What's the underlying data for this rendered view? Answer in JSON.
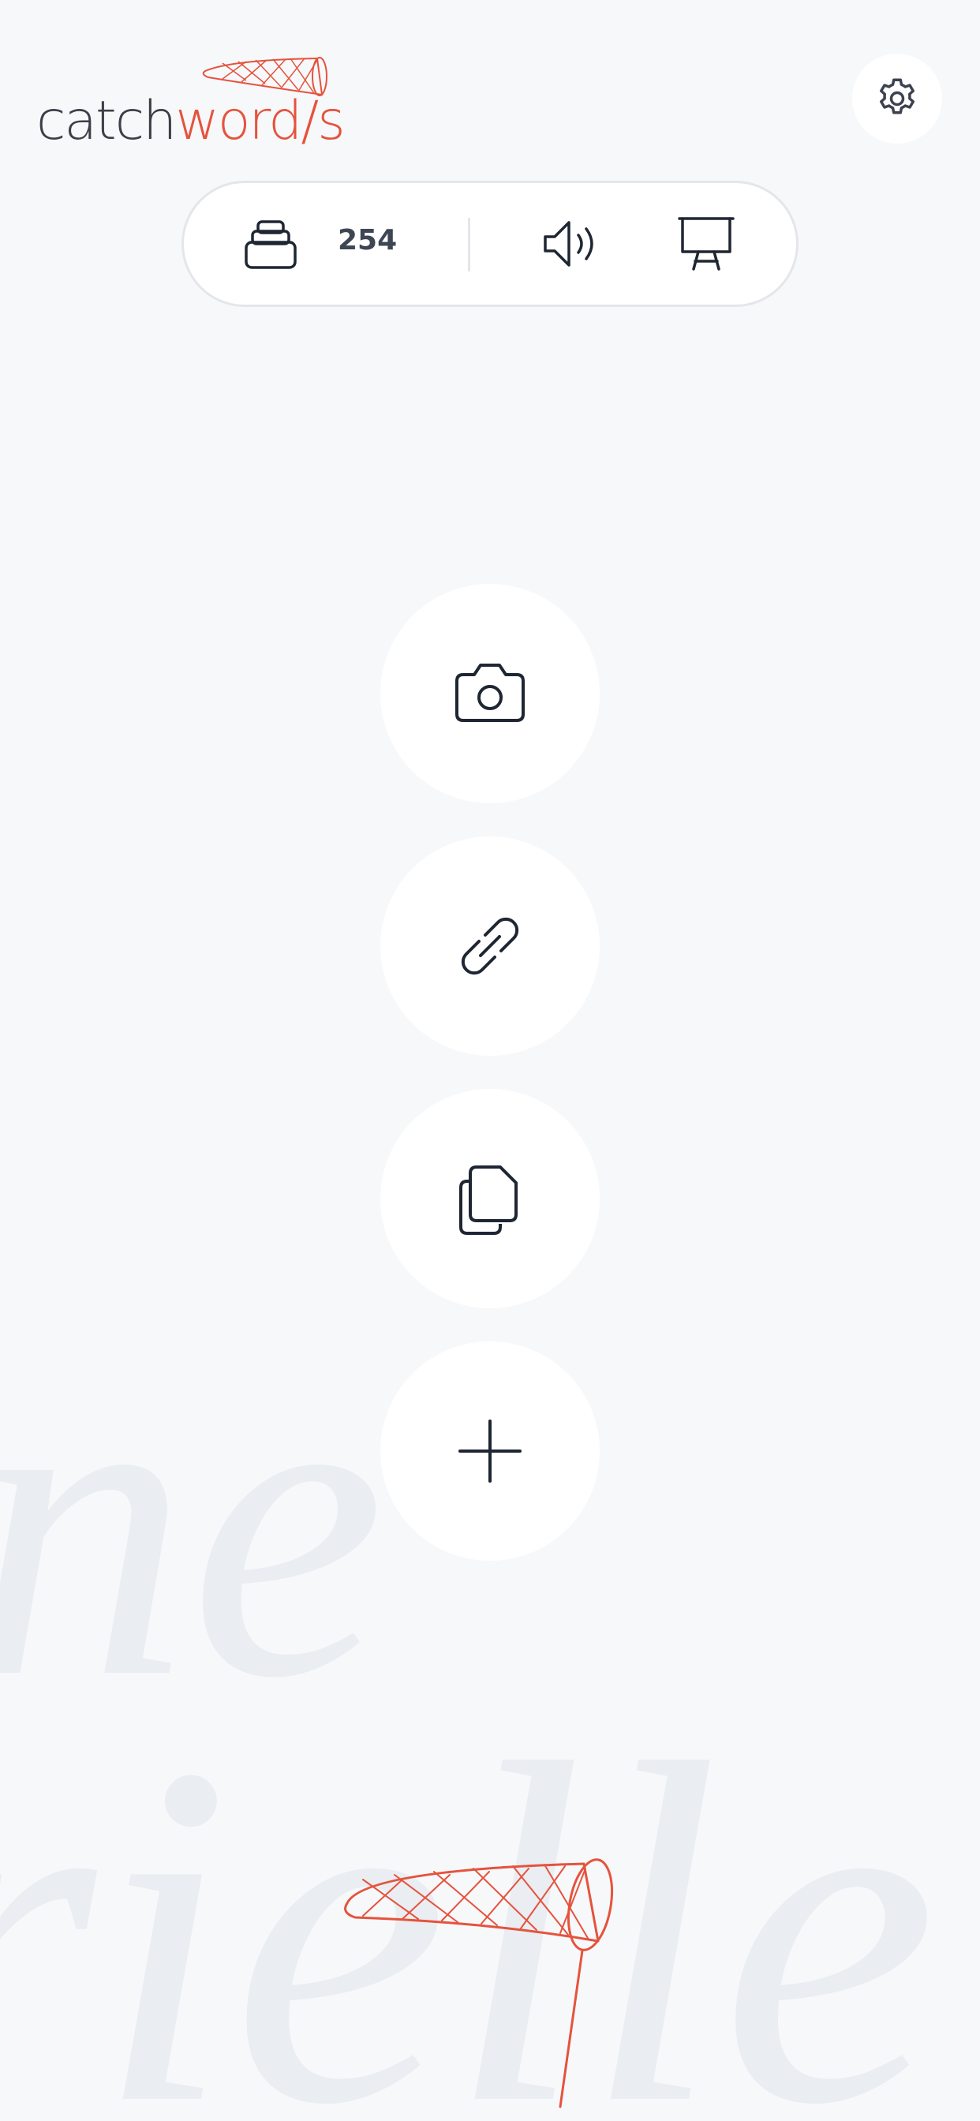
{
  "app": {
    "logo_dark": "catch",
    "logo_accent": "word/s",
    "brand_color": "#e5533d",
    "text_color": "#3c3f48"
  },
  "header": {
    "settings_icon": "gear-icon"
  },
  "toolbar": {
    "stack_icon": "stack-icon",
    "word_count": "254",
    "sound_icon": "speaker-icon",
    "board_icon": "presentation-board-icon"
  },
  "actions": [
    {
      "icon": "camera-icon"
    },
    {
      "icon": "link-icon"
    },
    {
      "icon": "copy-icon"
    },
    {
      "icon": "plus-icon"
    }
  ],
  "background": {
    "line1": "ne",
    "line2": "rielle"
  }
}
